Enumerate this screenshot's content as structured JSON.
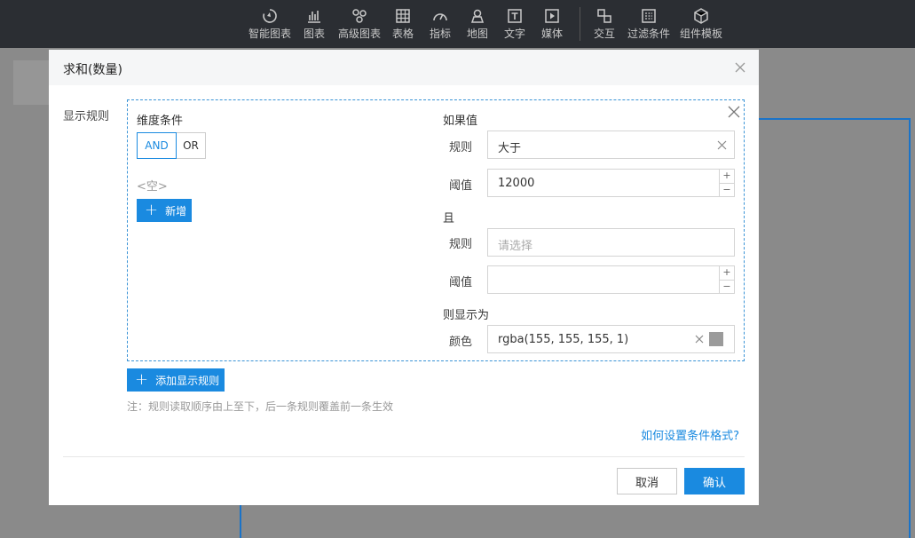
{
  "toolbar": {
    "items": [
      {
        "label": "智能图表",
        "icon": "smart-chart-icon"
      },
      {
        "label": "图表",
        "icon": "bar-chart-icon"
      },
      {
        "label": "高级图表",
        "icon": "advanced-chart-icon"
      },
      {
        "label": "表格",
        "icon": "table-icon"
      },
      {
        "label": "指标",
        "icon": "gauge-icon"
      },
      {
        "label": "地图",
        "icon": "map-icon"
      },
      {
        "label": "文字",
        "icon": "text-icon"
      },
      {
        "label": "媒体",
        "icon": "media-icon"
      },
      {
        "label": "交互",
        "icon": "interaction-icon"
      },
      {
        "label": "过滤条件",
        "icon": "filter-icon"
      },
      {
        "label": "组件模板",
        "icon": "template-icon"
      }
    ]
  },
  "modal": {
    "title": "求和(数量)",
    "side_label": "显示规则",
    "dimension": {
      "title": "维度条件",
      "and_label": "AND",
      "or_label": "OR",
      "empty_text": "<空>",
      "add_label": "新增"
    },
    "if_value": {
      "title": "如果值",
      "rule_label": "规则",
      "rule_value": "大于",
      "threshold_label": "阈值",
      "threshold_value": "12000"
    },
    "and_section": {
      "title": "且",
      "rule_label": "规则",
      "rule_placeholder": "请选择",
      "threshold_label": "阈值",
      "threshold_value": ""
    },
    "display_as": {
      "title": "则显示为",
      "color_label": "颜色",
      "color_value": "rgba(155, 155, 155, 1)",
      "swatch_color": "#9b9b9b"
    },
    "add_rule_label": "添加显示规则",
    "note": "注：规则读取顺序由上至下，后一条规则覆盖前一条生效",
    "help_link": "如何设置条件格式?",
    "cancel_label": "取消",
    "confirm_label": "确认"
  },
  "colors": {
    "accent": "#1a8ae0",
    "toolbar_bg": "#2b2e33",
    "overlay": "#8a8a8a"
  }
}
